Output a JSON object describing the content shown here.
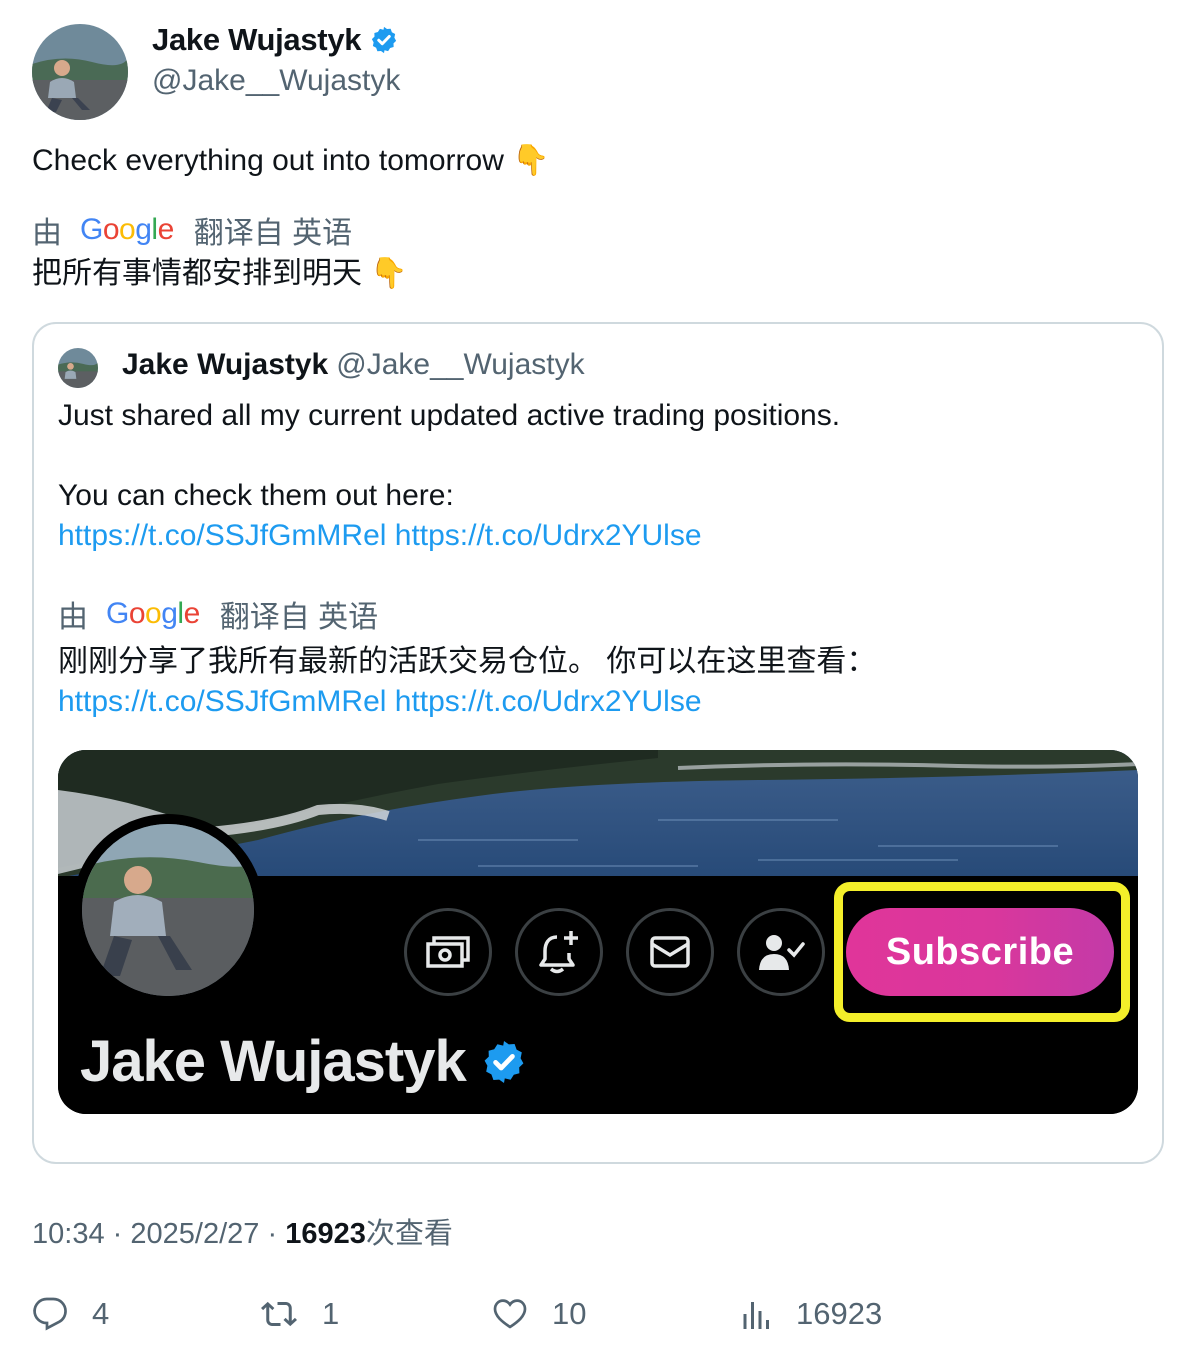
{
  "author": {
    "name": "Jake Wujastyk",
    "handle": "@Jake__Wujastyk",
    "verified": true
  },
  "tweet": {
    "text": "Check everything out into tomorrow",
    "emoji": "👇"
  },
  "translation_bar": {
    "by": "由",
    "provider": "Google",
    "provider_letters": [
      "G",
      "o",
      "o",
      "g",
      "l",
      "e"
    ],
    "from": "翻译自 英语"
  },
  "tweet_translated": "把所有事情都安排到明天",
  "quoted_tweet": {
    "name": "Jake Wujastyk",
    "handle": "@Jake__Wujastyk",
    "line1": "Just shared all my current updated active trading positions.",
    "line2": "You can check them out here:",
    "links": "https://t.co/SSJfGmMRel https://t.co/Udrx2YUlse",
    "translated_text": "刚刚分享了我所有最新的活跃交易仓位。 你可以在这里查看：",
    "translated_links": "https://t.co/SSJfGmMRel https://t.co/Udrx2YUlse",
    "media": {
      "subscribe_label": "Subscribe",
      "profile_name": "Jake Wujastyk",
      "icons": [
        "money-icon",
        "bell-plus-icon",
        "mail-icon",
        "person-check-icon"
      ]
    }
  },
  "meta": {
    "time": "10:34",
    "separator": "·",
    "date": "2025/2/27",
    "views_count": "16923",
    "views_label": "次查看"
  },
  "actions": {
    "replies": "4",
    "retweets": "1",
    "likes": "10",
    "views": "16923"
  },
  "colors": {
    "link": "#1d9bf0",
    "secondary": "#536471",
    "verified": "#1d9bf0",
    "subscribe": "#e0359a",
    "highlight": "#f4ef2a"
  }
}
